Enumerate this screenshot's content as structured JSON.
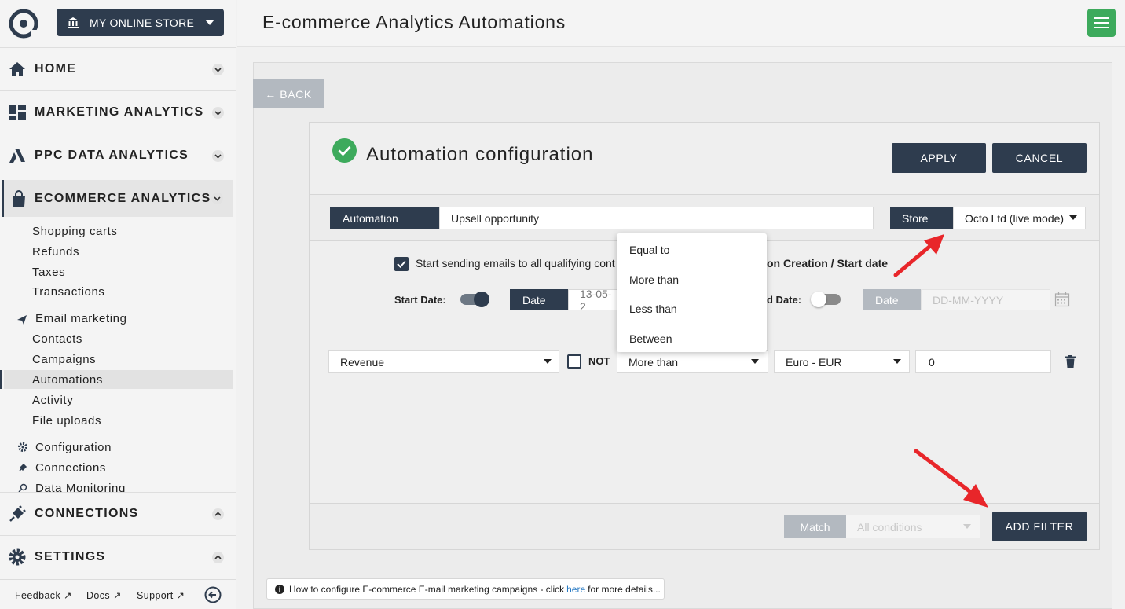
{
  "store_selector": {
    "label": "MY ONLINE STORE"
  },
  "sidebar": {
    "sections": [
      {
        "label": "HOME",
        "icon": "home-icon"
      },
      {
        "label": "MARKETING ANALYTICS",
        "icon": "dashboard-icon"
      },
      {
        "label": "PPC DATA ANALYTICS",
        "icon": "ads-icon"
      },
      {
        "label": "ECOMMERCE ANALYTICS",
        "icon": "shopping-bag-icon"
      },
      {
        "label": "CONNECTIONS",
        "icon": "plug-icon"
      },
      {
        "label": "SETTINGS",
        "icon": "gear-icon"
      }
    ],
    "ecommerce_items": [
      "Shopping carts",
      "Refunds",
      "Taxes",
      "Transactions"
    ],
    "email_marketing": "Email marketing",
    "email_items": [
      "Contacts",
      "Campaigns",
      "Automations",
      "Activity",
      "File uploads"
    ],
    "other_items": [
      "Configuration",
      "Connections",
      "Data Monitoring"
    ],
    "footer": {
      "feedback": "Feedback",
      "docs": "Docs",
      "support": "Support"
    }
  },
  "header": {
    "title": "E-commerce Analytics Automations"
  },
  "back_label": "← BACK",
  "config": {
    "title": "Automation configuration",
    "apply": "APPLY",
    "cancel": "CANCEL",
    "automation_label": "Automation",
    "automation_value": "Upsell opportunity",
    "store_label": "Store",
    "store_value": "Octo Ltd (live mode)",
    "send_text_left": "Start sending emails to all qualifying cont",
    "send_text_right": "on Creation / Start date",
    "start_date_label": "Start Date:",
    "date_tag": "Date",
    "start_date_value": "13-05-2",
    "end_date_label": "d Date:",
    "end_date_placeholder": "DD-MM-YYYY"
  },
  "filter": {
    "metric": "Revenue",
    "not_label": "NOT",
    "operator": "More than",
    "currency": "Euro - EUR",
    "value": "0"
  },
  "operator_options": [
    "Equal to",
    "More than",
    "Less than",
    "Between"
  ],
  "bottom": {
    "match_label": "Match",
    "match_value": "All conditions",
    "add_filter": "ADD FILTER"
  },
  "info": {
    "text_before": "How to configure E-commerce E-mail marketing campaigns - click",
    "link": "here",
    "text_after": "for more details..."
  },
  "colors": {
    "primary": "#2e3c4e",
    "success": "#3daa5c",
    "annotation": "#e8262a",
    "link": "#2a7bc4"
  }
}
